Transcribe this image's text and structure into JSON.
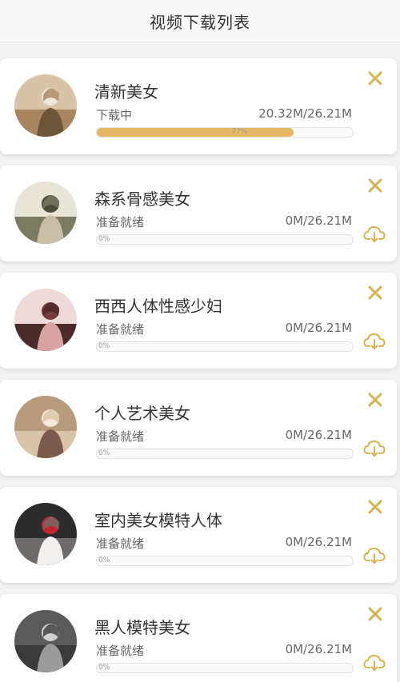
{
  "header": {
    "title": "视频下载列表"
  },
  "colors": {
    "accent": "#d8b24c",
    "progress_fill": "#e7b864",
    "text_primary": "#333333",
    "text_secondary": "#666666"
  },
  "icons": {
    "close": "close-icon",
    "download": "cloud-download-icon"
  },
  "items": [
    {
      "title": "清新美女",
      "status": "下载中",
      "size": "20.32M/26.21M",
      "progress_label": "77%",
      "progress": 0.77,
      "show_download": false,
      "avatar": "avatar-1"
    },
    {
      "title": "森系骨感美女",
      "status": "准备就绪",
      "size": "0M/26.21M",
      "progress_label": "0%",
      "progress": 0,
      "show_download": true,
      "avatar": "avatar-2"
    },
    {
      "title": "西西人体性感少妇",
      "status": "准备就绪",
      "size": "0M/26.21M",
      "progress_label": "0%",
      "progress": 0,
      "show_download": true,
      "avatar": "avatar-3"
    },
    {
      "title": "个人艺术美女",
      "status": "准备就绪",
      "size": "0M/26.21M",
      "progress_label": "0%",
      "progress": 0,
      "show_download": true,
      "avatar": "avatar-4"
    },
    {
      "title": "室内美女模特人体",
      "status": "准备就绪",
      "size": "0M/26.21M",
      "progress_label": "0%",
      "progress": 0,
      "show_download": true,
      "avatar": "avatar-5"
    },
    {
      "title": "黑人模特美女",
      "status": "准备就绪",
      "size": "0M/26.21M",
      "progress_label": "0%",
      "progress": 0,
      "show_download": true,
      "avatar": "avatar-6"
    }
  ]
}
